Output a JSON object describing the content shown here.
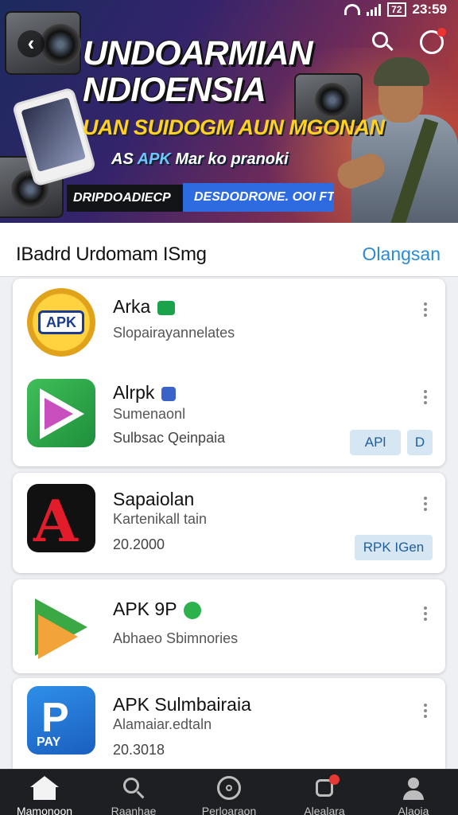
{
  "status_bar": {
    "time": "23:59",
    "battery": "72"
  },
  "banner": {
    "title_line1": "UNDOARMIAN",
    "title_line2": "NDIOENSIA",
    "subtitle": "UAN SUIDOGM AUN MGONAN",
    "tag_prefix": "AS",
    "tag_brand": "APK",
    "tag_rest": "Mar ko pranoki",
    "download_left": "DRIPDOADIECP",
    "download_right": "DESDODRONE. OOI FT"
  },
  "section": {
    "title": "IBadrd Urdomam ISmg",
    "link": "Olangsan"
  },
  "apps": [
    {
      "name": "Arka",
      "subtitle": "Slopairayannelates",
      "badge_color": "#1aa34a",
      "accent_color": "#e53935"
    },
    {
      "name": "Alrpk",
      "subtitle": "Sumenaonl",
      "meta": "Sulbsac Qeinpaia",
      "button_primary": "APl",
      "button_secondary": "D"
    },
    {
      "name": "Sapaiolan",
      "subtitle": "Kartenikall tain",
      "meta": "20.2000",
      "button": "RPK IGen"
    },
    {
      "name": "APK 9P",
      "subtitle": "Abhaeo Sbimnories",
      "badge_color": "#2bb24c"
    },
    {
      "name": "APK Sulmbairaia",
      "subtitle": "Alamaiar.edtaln",
      "meta": "20.3018"
    }
  ],
  "bottom_nav": [
    {
      "label": "Mamonoon",
      "icon": "home-icon",
      "active": true
    },
    {
      "label": "Raanhae",
      "icon": "search-icon",
      "active": false
    },
    {
      "label": "Perloaraon",
      "icon": "compass-icon",
      "active": false
    },
    {
      "label": "Alealara",
      "icon": "bell-icon",
      "active": false
    },
    {
      "label": "Alaoia",
      "icon": "user-icon",
      "active": false
    }
  ]
}
